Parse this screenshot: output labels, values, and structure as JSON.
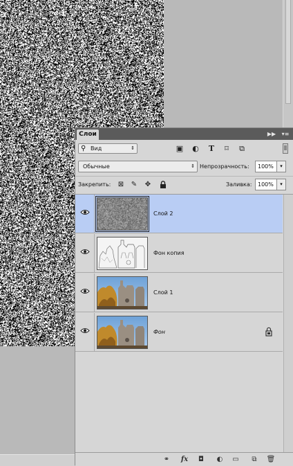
{
  "panel": {
    "tab_label": "Слои",
    "collapse_icon": "double-chevron-right-icon",
    "menu_icon": "panel-menu-icon"
  },
  "filter": {
    "search_icon": "search-icon",
    "kind_value": "Вид",
    "kind_arrow": "⇕",
    "buttons": [
      {
        "icon": "image-filter-icon",
        "glyph": "▣"
      },
      {
        "icon": "adjustment-filter-icon",
        "glyph": "◐"
      },
      {
        "icon": "type-filter-icon",
        "glyph": "T"
      },
      {
        "icon": "shape-filter-icon",
        "glyph": "⌑"
      },
      {
        "icon": "smart-object-filter-icon",
        "glyph": "⧉"
      }
    ]
  },
  "blend": {
    "mode": "Обычные",
    "mode_arrow": "⇕",
    "opacity_label": "Непрозрачность:",
    "opacity_value": "100%",
    "dropdown_arrow": "▾"
  },
  "lock": {
    "label": "Закрепить:",
    "buttons": [
      {
        "icon": "lock-transparent-pixels-icon",
        "glyph": "⊠"
      },
      {
        "icon": "lock-image-pixels-icon",
        "glyph": "✎"
      },
      {
        "icon": "lock-position-icon",
        "glyph": "✥"
      },
      {
        "icon": "lock-all-icon",
        "glyph": "🔒"
      }
    ],
    "fill_label": "Заливка:",
    "fill_value": "100%"
  },
  "layers": [
    {
      "name": "Слой 2",
      "selected": true,
      "italic": false,
      "visible_icon": "eye-icon",
      "thumb": "noise",
      "locked": false
    },
    {
      "name": "Фон копия",
      "selected": false,
      "italic": false,
      "visible_icon": "eye-icon",
      "thumb": "sketch",
      "locked": false
    },
    {
      "name": "Слой 1",
      "selected": false,
      "italic": false,
      "visible_icon": "eye-icon",
      "thumb": "photo",
      "locked": false
    },
    {
      "name": "Фон",
      "selected": false,
      "italic": true,
      "visible_icon": "eye-icon",
      "thumb": "photo",
      "locked": true
    }
  ],
  "bottom_bar": [
    {
      "icon": "link-layers-icon",
      "glyph": "⚭"
    },
    {
      "icon": "fx-icon",
      "glyph": "fx"
    },
    {
      "icon": "add-mask-icon",
      "glyph": "◘"
    },
    {
      "icon": "adjustment-layer-icon",
      "glyph": "◐"
    },
    {
      "icon": "new-group-icon",
      "glyph": "▭"
    },
    {
      "icon": "new-layer-icon",
      "glyph": "⧉"
    },
    {
      "icon": "delete-layer-icon",
      "glyph": "🗑"
    }
  ],
  "colors": {
    "panel_bg": "#d6d6d6",
    "selected_row": "#b9cdf4",
    "titlebar": "#5b5b5b",
    "workspace": "#b9b9b9"
  }
}
